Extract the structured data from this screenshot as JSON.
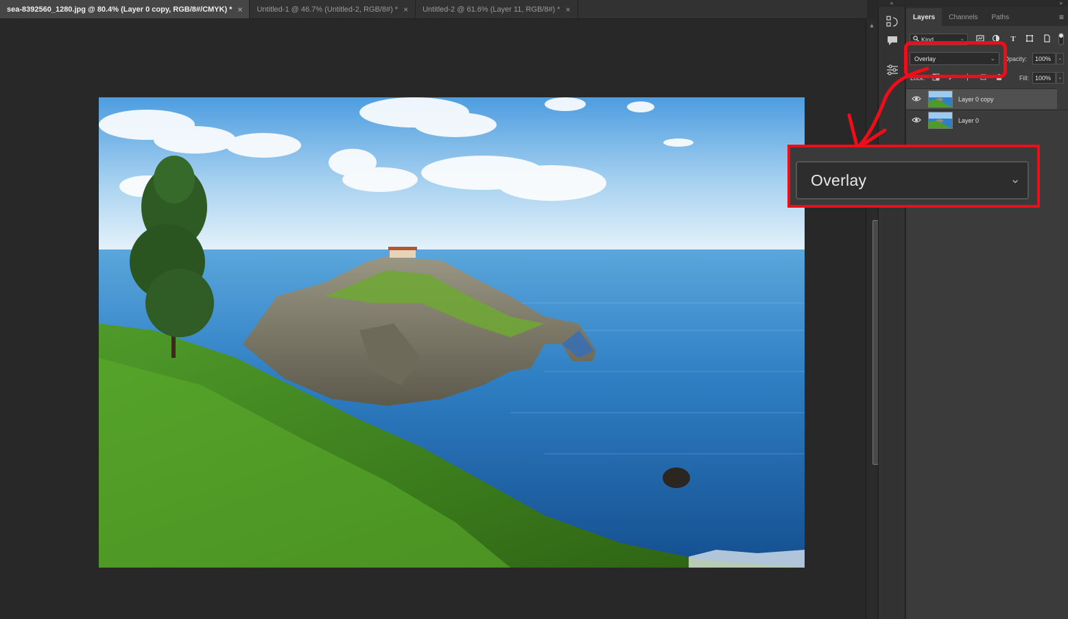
{
  "tabs": [
    {
      "label": "sea-8392560_1280.jpg @ 80.4% (Layer 0 copy, RGB/8#/CMYK) *",
      "active": true
    },
    {
      "label": "Untitled-1 @ 46.7% (Untitled-2, RGB/8#) *",
      "active": false
    },
    {
      "label": "Untitled-2 @ 61.6% (Layer 11, RGB/8#) *",
      "active": false
    }
  ],
  "tab_close_glyph": "×",
  "panel": {
    "tabs": [
      "Layers",
      "Channels",
      "Paths"
    ],
    "filter_kind": "Kind",
    "blend_mode": "Overlay",
    "opacity_label": "Opacity:",
    "opacity_value": "100%",
    "lock_label": "Lock:",
    "fill_label": "Fill:",
    "fill_value": "100%",
    "layers": [
      {
        "name": "Layer 0 copy",
        "selected": true,
        "visible": true
      },
      {
        "name": "Layer 0",
        "selected": false,
        "visible": true
      }
    ]
  },
  "callout": {
    "blend_mode": "Overlay"
  },
  "icons": {
    "collapse": "«",
    "expand": "»",
    "panel_menu": "≡",
    "chevron": "⌄"
  },
  "colors": {
    "annotation": "#f00d1a",
    "app_bg": "#282828",
    "panel_bg": "#3b3b3b"
  }
}
